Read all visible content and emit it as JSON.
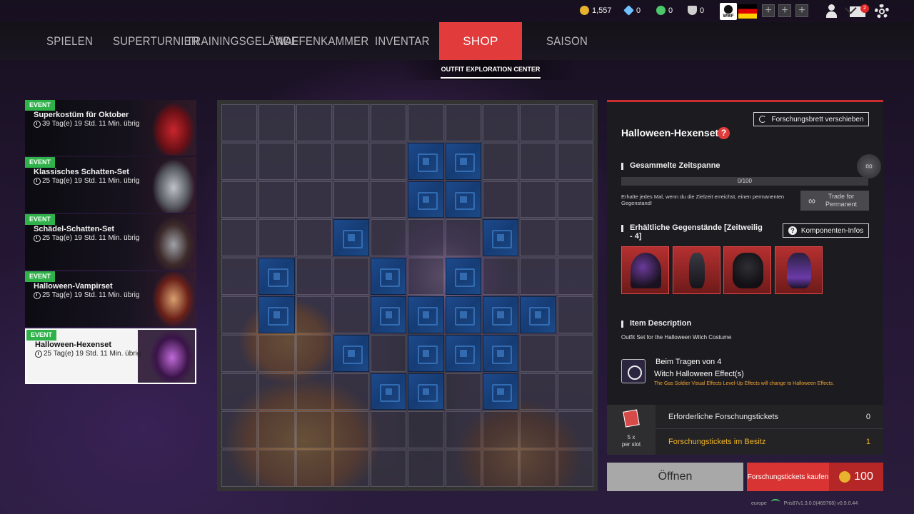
{
  "currencies": [
    {
      "icon": "gold-coin-icon",
      "value": "1,557",
      "color": "#e8b22c"
    },
    {
      "icon": "diamond-icon",
      "value": "0",
      "color": "#6fc2ff"
    },
    {
      "icon": "green-coin-icon",
      "value": "0",
      "color": "#4cc86a"
    },
    {
      "icon": "shield-token-icon",
      "value": "0",
      "color": "#cfcfcf"
    }
  ],
  "header": {
    "wwf_label": "WWF",
    "plus_label": "+",
    "mail_badge": "2"
  },
  "nav": {
    "items": [
      "SPIELEN",
      "SUPERTURNIER",
      "TRAININGSGELÄNDE",
      "WAFFENKAMMER",
      "INVENTAR",
      "SHOP",
      "SAISON"
    ],
    "active": "SHOP",
    "subtab": "OUTFIT EXPLORATION CENTER"
  },
  "events": [
    {
      "badge": "EVENT",
      "title": "Superkostüm für Oktober",
      "timer": "39 Tag(e) 19 Std. 11 Min. übrig",
      "selected": false
    },
    {
      "badge": "EVENT",
      "title": "Klassisches Schatten-Set",
      "timer": "25 Tag(e) 19 Std. 11 Min. übrig",
      "selected": false
    },
    {
      "badge": "EVENT",
      "title": "Schädel-Schatten-Set",
      "timer": "25 Tag(e) 19 Std. 11 Min. übrig",
      "selected": false
    },
    {
      "badge": "EVENT",
      "title": "Halloween-Vampirset",
      "timer": "25 Tag(e) 19 Std. 11 Min. übrig",
      "selected": false
    },
    {
      "badge": "EVENT",
      "title": "Halloween-Hexenset",
      "timer": "25 Tag(e) 19 Std. 11 Min. übrig",
      "selected": true
    }
  ],
  "board": {
    "size": 10,
    "tiles": [
      [
        1,
        5
      ],
      [
        1,
        6
      ],
      [
        2,
        5
      ],
      [
        2,
        6
      ],
      [
        3,
        3
      ],
      [
        3,
        7
      ],
      [
        4,
        1
      ],
      [
        4,
        4
      ],
      [
        4,
        6
      ],
      [
        5,
        1
      ],
      [
        5,
        4
      ],
      [
        5,
        5
      ],
      [
        5,
        6
      ],
      [
        5,
        7
      ],
      [
        5,
        8
      ],
      [
        6,
        3
      ],
      [
        6,
        5
      ],
      [
        6,
        6
      ],
      [
        6,
        7
      ],
      [
        7,
        4
      ],
      [
        7,
        5
      ],
      [
        7,
        7
      ]
    ]
  },
  "panel": {
    "title": "Halloween-Hexenset",
    "help": "?",
    "move_board": "Forschungsbrett verschieben",
    "collected_label": "Gesammelte Zeitspanne",
    "progress_text": "0/100",
    "progress_value": 0,
    "infinity": "∞",
    "note": "Erhalte jedes Mal, wenn du die Zielzeit erreichst, einen permanenten Gegenstand!",
    "trade_label": "Trade for Permanent",
    "items_label": "Erhältliche Gegenstände [Zeitweilig - 4]",
    "components_btn": "Komponenten-Infos",
    "item_icons": [
      "witch-hat-icon",
      "witch-dress-icon",
      "gloves-icon",
      "boots-icon"
    ],
    "desc_label": "Item Description",
    "desc_text": "Outfit Set for the Halloween Witch Costume",
    "effect_line1": "Beim Tragen von 4",
    "effect_line2": "Witch Halloween Effect(s)",
    "effect_note": "The Gas Soldier Visual Effects Level-Up Effects will change to Halloween Effects."
  },
  "tickets": {
    "per_slot": "5 x",
    "per_slot_2": "per slot",
    "required_label": "Erforderliche Forschungstickets",
    "required_value": "0",
    "owned_label": "Forschungstickets im Besitz",
    "owned_value": "1"
  },
  "buttons": {
    "open": "Öffnen",
    "buy_label": "Forschungstickets kaufen",
    "buy_price": "100"
  },
  "footer": {
    "region": "europe",
    "version": "Pris87v1.3.0.0(469768) v0.9.0.44"
  }
}
